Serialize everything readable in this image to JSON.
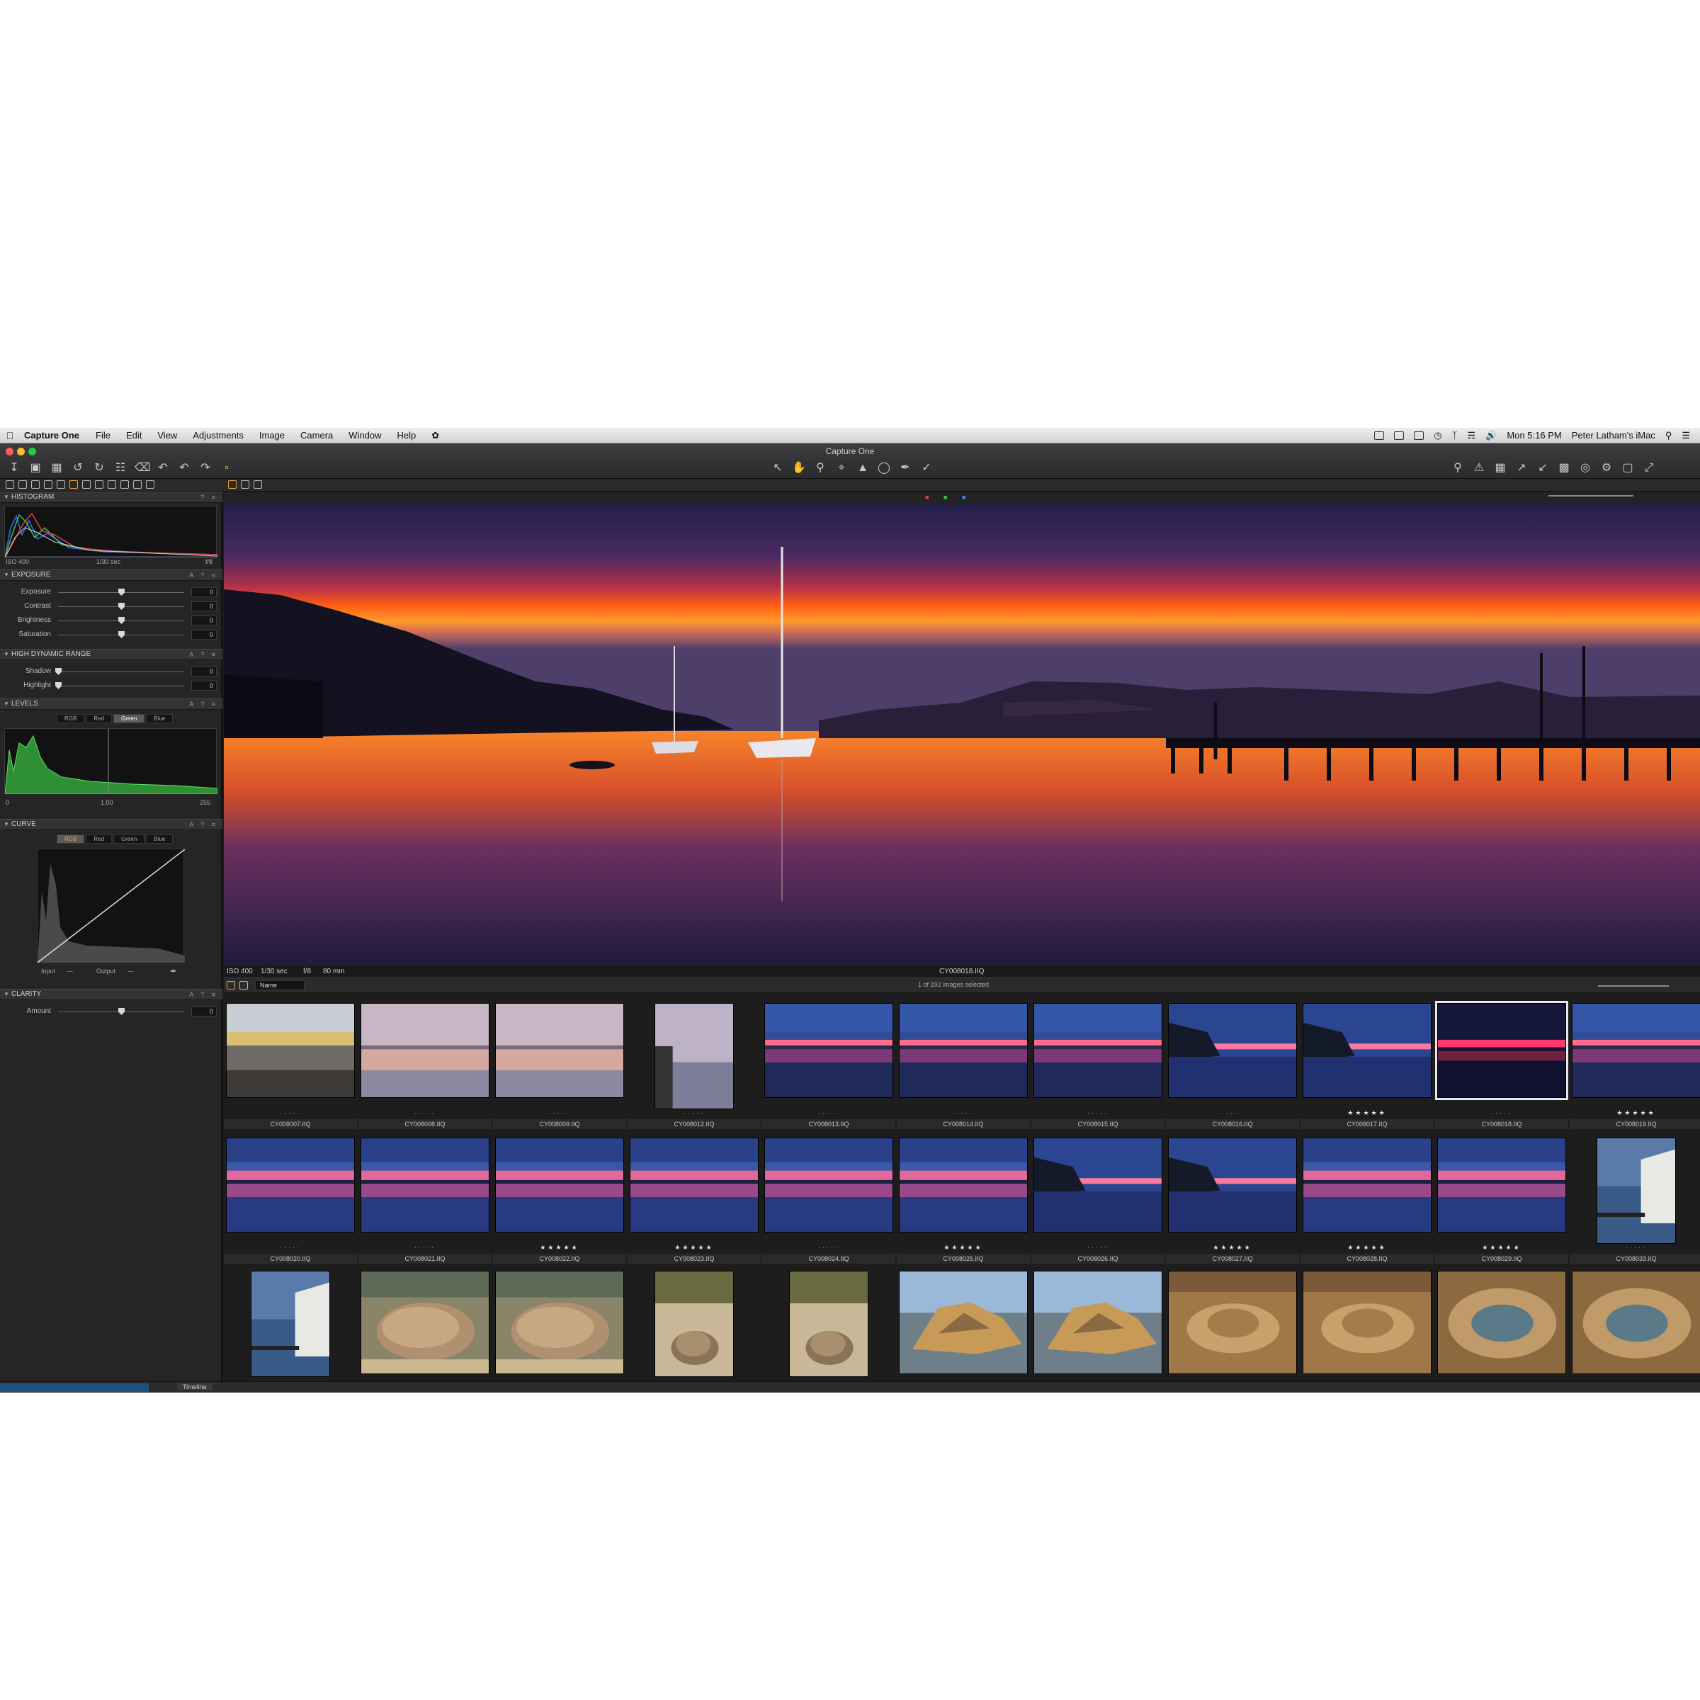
{
  "menubar": {
    "app_name": "Capture One",
    "menus": [
      "File",
      "Edit",
      "View",
      "Adjustments",
      "Image",
      "Camera",
      "Window",
      "Help"
    ],
    "clock": "Mon 5:16 PM",
    "user": "Peter Latham's iMac"
  },
  "window": {
    "title": "Capture One"
  },
  "panel": {
    "histogram": {
      "title": "HISTOGRAM",
      "iso": "ISO 400",
      "shutter": "1/30 sec",
      "aperture": "f/8"
    },
    "exposure": {
      "title": "EXPOSURE",
      "sliders": [
        {
          "label": "Exposure",
          "value": "0",
          "position": 0.5
        },
        {
          "label": "Contrast",
          "value": "0",
          "position": 0.5
        },
        {
          "label": "Brightness",
          "value": "0",
          "position": 0.5
        },
        {
          "label": "Saturation",
          "value": "0",
          "position": 0.5
        }
      ]
    },
    "hdr": {
      "title": "HIGH DYNAMIC RANGE",
      "sliders": [
        {
          "label": "Shadow",
          "value": "0",
          "position": 0.0
        },
        {
          "label": "Highlight",
          "value": "0",
          "position": 0.0
        }
      ]
    },
    "levels": {
      "title": "LEVELS",
      "channels": [
        "RGB",
        "Red",
        "Green",
        "Blue"
      ],
      "selected": "Green",
      "low": "0",
      "mid": "1.00",
      "high": "255"
    },
    "curve": {
      "title": "CURVE",
      "channels": [
        "RGB",
        "Red",
        "Green",
        "Blue"
      ],
      "selected": "RGB",
      "input_label": "Input",
      "input_value": "---",
      "output_label": "Output",
      "output_value": "---"
    },
    "clarity": {
      "title": "CLARITY",
      "sliders": [
        {
          "label": "Amount",
          "value": "0",
          "position": 0.5
        }
      ]
    }
  },
  "viewer": {
    "info": {
      "iso": "ISO 400",
      "shutter": "1/30 sec",
      "aperture": "f/8",
      "focal": "80 mm"
    },
    "filename": "CY008018.IIQ",
    "colors": {
      "sky_top": "#2a2350",
      "sky_mid": "#7a2a5a",
      "band": "#ff6a1a",
      "water": "#2a2545"
    }
  },
  "browser": {
    "sort_label": "Name",
    "selection": "1 of 192 images selected",
    "rows": [
      [
        {
          "name": "CY008007.IIQ",
          "scene": "shore",
          "rated": false
        },
        {
          "name": "CY008008.IIQ",
          "scene": "pastel",
          "rated": false
        },
        {
          "name": "CY008009.IIQ",
          "scene": "pastel",
          "rated": false
        },
        {
          "name": "CY008012.IIQ",
          "scene": "pastel-portrait",
          "rated": false
        },
        {
          "name": "CY008013.IIQ",
          "scene": "blue-dusk",
          "rated": false
        },
        {
          "name": "CY008014.IIQ",
          "scene": "blue-dusk",
          "rated": false
        },
        {
          "name": "CY008015.IIQ",
          "scene": "blue-dusk",
          "rated": false
        },
        {
          "name": "CY008016.IIQ",
          "scene": "blue-island",
          "rated": false
        },
        {
          "name": "CY008017.IIQ",
          "scene": "blue-island",
          "rated": true
        },
        {
          "name": "CY008018.IIQ",
          "scene": "night-sunset",
          "rated": false,
          "selected": true
        },
        {
          "name": "CY008019.IIQ",
          "scene": "blue-dusk",
          "rated": true
        }
      ],
      [
        {
          "name": "CY008020.IIQ",
          "scene": "blue-pink",
          "rated": false
        },
        {
          "name": "CY008021.IIQ",
          "scene": "blue-pink",
          "rated": false
        },
        {
          "name": "CY008022.IIQ",
          "scene": "blue-pink",
          "rated": true
        },
        {
          "name": "CY008023.IIQ",
          "scene": "blue-pink",
          "rated": true
        },
        {
          "name": "CY008024.IIQ",
          "scene": "blue-pink",
          "rated": false
        },
        {
          "name": "CY008025.IIQ",
          "scene": "blue-pink",
          "rated": true
        },
        {
          "name": "CY008026.IIQ",
          "scene": "blue-island",
          "rated": false
        },
        {
          "name": "CY008027.IIQ",
          "scene": "blue-island",
          "rated": true
        },
        {
          "name": "CY008028.IIQ",
          "scene": "blue-pink",
          "rated": true
        },
        {
          "name": "CY008029.IIQ",
          "scene": "blue-pink",
          "rated": true
        },
        {
          "name": "CY008033.IIQ",
          "scene": "boathouse-portrait",
          "rated": false
        }
      ],
      [
        {
          "name": "",
          "scene": "boathouse-portrait"
        },
        {
          "name": "",
          "scene": "boulder"
        },
        {
          "name": "",
          "scene": "boulder"
        },
        {
          "name": "",
          "scene": "boulder-portrait"
        },
        {
          "name": "",
          "scene": "boulder-portrait"
        },
        {
          "name": "",
          "scene": "rock-blue"
        },
        {
          "name": "",
          "scene": "rock-blue"
        },
        {
          "name": "",
          "scene": "sand"
        },
        {
          "name": "",
          "scene": "sand"
        },
        {
          "name": "",
          "scene": "sand-pool"
        },
        {
          "name": "",
          "scene": "sand-pool"
        }
      ]
    ]
  },
  "bottom": {
    "tab_label": "Timeline"
  }
}
